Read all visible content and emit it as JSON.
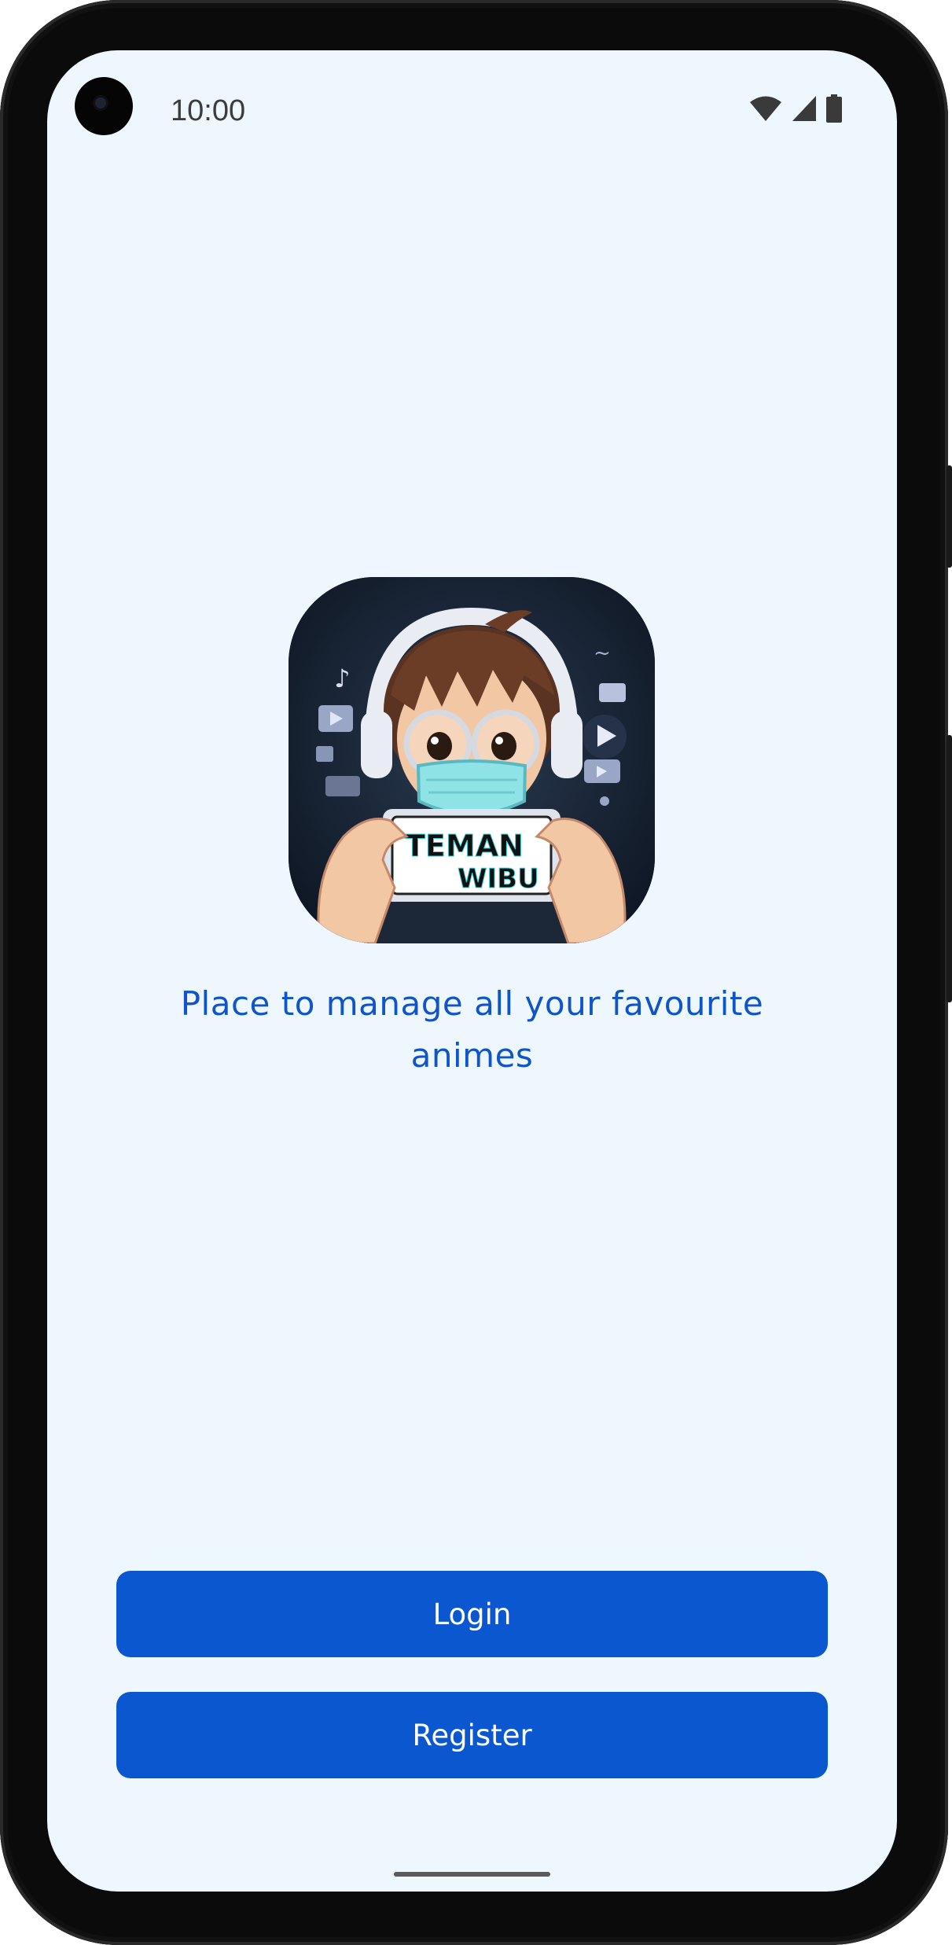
{
  "status_bar": {
    "time": "10:00",
    "icons": [
      "wifi-icon",
      "cellular-signal-icon",
      "battery-icon"
    ]
  },
  "logo": {
    "icon": "teman-wibu-logo",
    "lettering": "TEMAN WIBU"
  },
  "tagline": "Place to manage all your favourite animes",
  "buttons": {
    "login_label": "Login",
    "register_label": "Register"
  },
  "colors": {
    "accent": "#0b57d0",
    "tagline": "#1055c8",
    "background": "#eef7fd"
  }
}
